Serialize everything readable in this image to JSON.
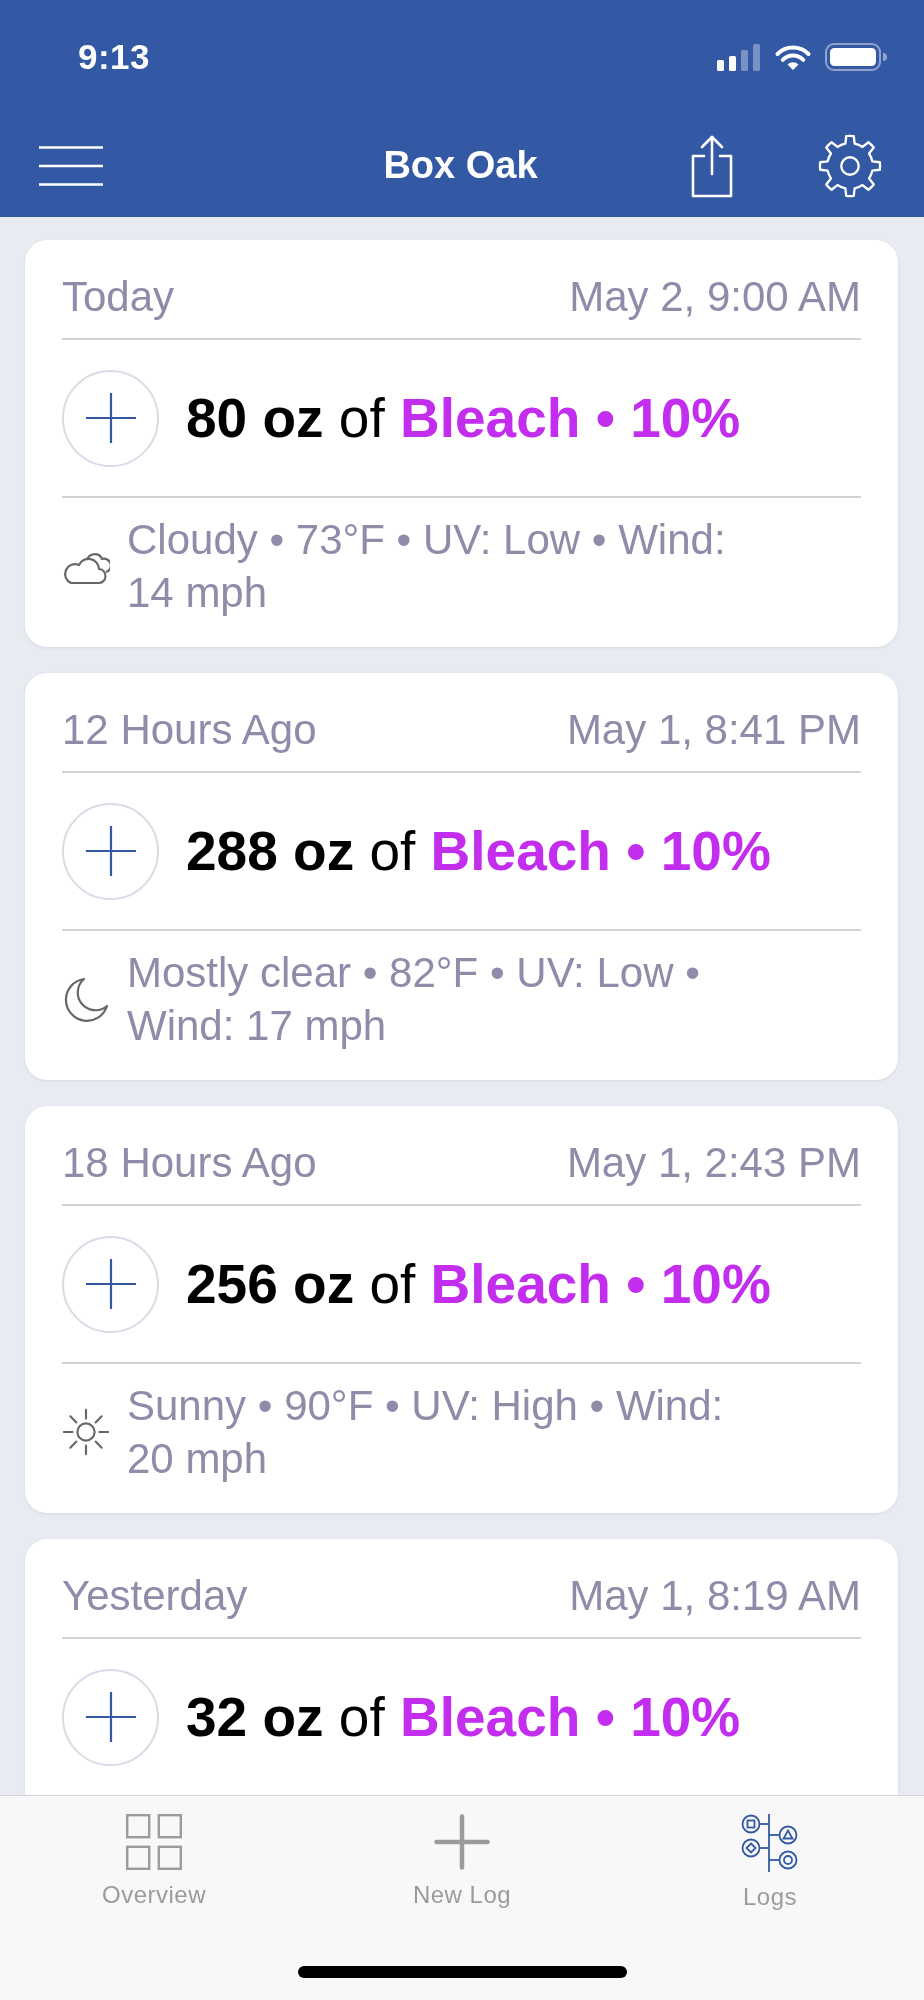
{
  "status_bar": {
    "time": "9:13"
  },
  "nav_bar": {
    "title": "Box Oak"
  },
  "logs": [
    {
      "relative_time": "Today",
      "timestamp": "May 2, 9:00 AM",
      "amount": "80 oz",
      "joiner": "of",
      "product": "Bleach • 10%",
      "weather": {
        "kind": "cloudy",
        "text": "Cloudy • 73°F • UV: Low • Wind: 14 mph"
      }
    },
    {
      "relative_time": "12 Hours Ago",
      "timestamp": "May 1, 8:41 PM",
      "amount": "288 oz",
      "joiner": "of",
      "product": "Bleach • 10%",
      "weather": {
        "kind": "night",
        "text": "Mostly clear • 82°F • UV: Low • Wind: 17 mph"
      }
    },
    {
      "relative_time": "18 Hours Ago",
      "timestamp": "May 1, 2:43 PM",
      "amount": "256 oz",
      "joiner": "of",
      "product": "Bleach • 10%",
      "weather": {
        "kind": "sunny",
        "text": "Sunny • 90°F • UV: High • Wind: 20 mph"
      }
    },
    {
      "relative_time": "Yesterday",
      "timestamp": "May 1, 8:19 AM",
      "amount": "32 oz",
      "joiner": "of",
      "product": "Bleach • 10%"
    }
  ],
  "tab_bar": [
    {
      "kind": "overview",
      "label": "Overview",
      "selected": false
    },
    {
      "kind": "new_log",
      "label": "New Log",
      "selected": false
    },
    {
      "kind": "logs",
      "label": "Logs",
      "selected": true
    }
  ]
}
